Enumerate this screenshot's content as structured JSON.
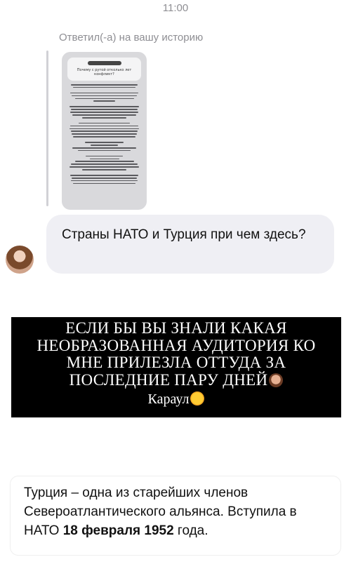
{
  "chat": {
    "time": "11:00",
    "reply_note": "Ответил(-а) на вашу историю",
    "story_preview": {
      "question": "Почему с рутой отколько лет конфликт?"
    },
    "message": "Страны НАТО и Турция при чем здесь?"
  },
  "banner": {
    "line1": "ЕСЛИ БЫ ВЫ ЗНАЛИ КАКАЯ",
    "line2": "НЕОБРАЗОВАННАЯ  АУДИТОРИЯ КО",
    "line3": "МНЕ ПРИЛЕЗЛА ОТТУДА ЗА",
    "line4": "ПОСЛЕДНИЕ ПАРУ ДНЕЙ",
    "line5": "Караул"
  },
  "fact": {
    "text_before": "Турция – одна из старейших членов Североатлантического альянса. Вступила в НАТО ",
    "date": "18 февраля 1952",
    "text_after": " года."
  },
  "colors": {
    "timestamp": "#8e8e93",
    "bubble": "#efeff4",
    "banner_bg": "#000000",
    "banner_text": "#ffffff"
  }
}
